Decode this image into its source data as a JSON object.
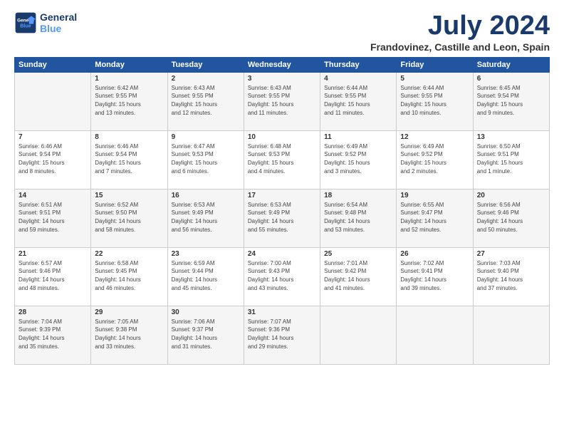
{
  "header": {
    "logo_line1": "General",
    "logo_line2": "Blue",
    "month": "July 2024",
    "location": "Frandovinez, Castille and Leon, Spain"
  },
  "weekdays": [
    "Sunday",
    "Monday",
    "Tuesday",
    "Wednesday",
    "Thursday",
    "Friday",
    "Saturday"
  ],
  "weeks": [
    [
      {
        "day": "",
        "info": ""
      },
      {
        "day": "1",
        "info": "Sunrise: 6:42 AM\nSunset: 9:55 PM\nDaylight: 15 hours\nand 13 minutes."
      },
      {
        "day": "2",
        "info": "Sunrise: 6:43 AM\nSunset: 9:55 PM\nDaylight: 15 hours\nand 12 minutes."
      },
      {
        "day": "3",
        "info": "Sunrise: 6:43 AM\nSunset: 9:55 PM\nDaylight: 15 hours\nand 11 minutes."
      },
      {
        "day": "4",
        "info": "Sunrise: 6:44 AM\nSunset: 9:55 PM\nDaylight: 15 hours\nand 11 minutes."
      },
      {
        "day": "5",
        "info": "Sunrise: 6:44 AM\nSunset: 9:55 PM\nDaylight: 15 hours\nand 10 minutes."
      },
      {
        "day": "6",
        "info": "Sunrise: 6:45 AM\nSunset: 9:54 PM\nDaylight: 15 hours\nand 9 minutes."
      }
    ],
    [
      {
        "day": "7",
        "info": "Sunrise: 6:46 AM\nSunset: 9:54 PM\nDaylight: 15 hours\nand 8 minutes."
      },
      {
        "day": "8",
        "info": "Sunrise: 6:46 AM\nSunset: 9:54 PM\nDaylight: 15 hours\nand 7 minutes."
      },
      {
        "day": "9",
        "info": "Sunrise: 6:47 AM\nSunset: 9:53 PM\nDaylight: 15 hours\nand 6 minutes."
      },
      {
        "day": "10",
        "info": "Sunrise: 6:48 AM\nSunset: 9:53 PM\nDaylight: 15 hours\nand 4 minutes."
      },
      {
        "day": "11",
        "info": "Sunrise: 6:49 AM\nSunset: 9:52 PM\nDaylight: 15 hours\nand 3 minutes."
      },
      {
        "day": "12",
        "info": "Sunrise: 6:49 AM\nSunset: 9:52 PM\nDaylight: 15 hours\nand 2 minutes."
      },
      {
        "day": "13",
        "info": "Sunrise: 6:50 AM\nSunset: 9:51 PM\nDaylight: 15 hours\nand 1 minute."
      }
    ],
    [
      {
        "day": "14",
        "info": "Sunrise: 6:51 AM\nSunset: 9:51 PM\nDaylight: 14 hours\nand 59 minutes."
      },
      {
        "day": "15",
        "info": "Sunrise: 6:52 AM\nSunset: 9:50 PM\nDaylight: 14 hours\nand 58 minutes."
      },
      {
        "day": "16",
        "info": "Sunrise: 6:53 AM\nSunset: 9:49 PM\nDaylight: 14 hours\nand 56 minutes."
      },
      {
        "day": "17",
        "info": "Sunrise: 6:53 AM\nSunset: 9:49 PM\nDaylight: 14 hours\nand 55 minutes."
      },
      {
        "day": "18",
        "info": "Sunrise: 6:54 AM\nSunset: 9:48 PM\nDaylight: 14 hours\nand 53 minutes."
      },
      {
        "day": "19",
        "info": "Sunrise: 6:55 AM\nSunset: 9:47 PM\nDaylight: 14 hours\nand 52 minutes."
      },
      {
        "day": "20",
        "info": "Sunrise: 6:56 AM\nSunset: 9:46 PM\nDaylight: 14 hours\nand 50 minutes."
      }
    ],
    [
      {
        "day": "21",
        "info": "Sunrise: 6:57 AM\nSunset: 9:46 PM\nDaylight: 14 hours\nand 48 minutes."
      },
      {
        "day": "22",
        "info": "Sunrise: 6:58 AM\nSunset: 9:45 PM\nDaylight: 14 hours\nand 46 minutes."
      },
      {
        "day": "23",
        "info": "Sunrise: 6:59 AM\nSunset: 9:44 PM\nDaylight: 14 hours\nand 45 minutes."
      },
      {
        "day": "24",
        "info": "Sunrise: 7:00 AM\nSunset: 9:43 PM\nDaylight: 14 hours\nand 43 minutes."
      },
      {
        "day": "25",
        "info": "Sunrise: 7:01 AM\nSunset: 9:42 PM\nDaylight: 14 hours\nand 41 minutes."
      },
      {
        "day": "26",
        "info": "Sunrise: 7:02 AM\nSunset: 9:41 PM\nDaylight: 14 hours\nand 39 minutes."
      },
      {
        "day": "27",
        "info": "Sunrise: 7:03 AM\nSunset: 9:40 PM\nDaylight: 14 hours\nand 37 minutes."
      }
    ],
    [
      {
        "day": "28",
        "info": "Sunrise: 7:04 AM\nSunset: 9:39 PM\nDaylight: 14 hours\nand 35 minutes."
      },
      {
        "day": "29",
        "info": "Sunrise: 7:05 AM\nSunset: 9:38 PM\nDaylight: 14 hours\nand 33 minutes."
      },
      {
        "day": "30",
        "info": "Sunrise: 7:06 AM\nSunset: 9:37 PM\nDaylight: 14 hours\nand 31 minutes."
      },
      {
        "day": "31",
        "info": "Sunrise: 7:07 AM\nSunset: 9:36 PM\nDaylight: 14 hours\nand 29 minutes."
      },
      {
        "day": "",
        "info": ""
      },
      {
        "day": "",
        "info": ""
      },
      {
        "day": "",
        "info": ""
      }
    ]
  ]
}
